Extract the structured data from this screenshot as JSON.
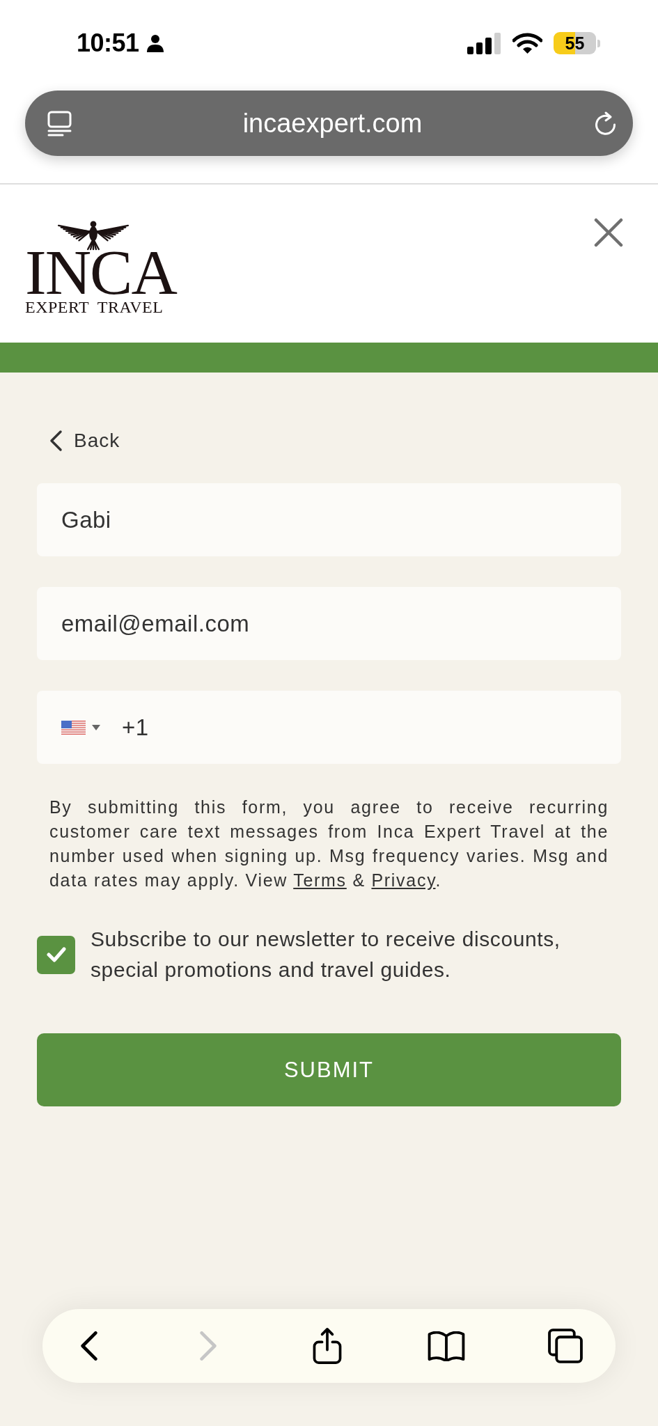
{
  "status_bar": {
    "time": "10:51",
    "battery": "55"
  },
  "address_bar": {
    "url": "incaexpert.com"
  },
  "header": {
    "logo_title": "INCA",
    "logo_subtitle": "EXPERT TRAVEL"
  },
  "form": {
    "back": "Back",
    "fields": [
      {
        "kind": "name",
        "value": "Gabi"
      },
      {
        "kind": "email",
        "value": "email@email.com"
      },
      {
        "kind": "phone",
        "value": "+1"
      }
    ],
    "consent": [
      {
        "kind": "text",
        "text": "By submitting this form, you agree to receive recurring customer care text messages from Inca Expert Travel at the number used when signing up. Msg frequency varies. Msg and data rates may apply. View "
      },
      {
        "kind": "link",
        "text": "Terms"
      },
      {
        "kind": "text",
        "text": " & "
      },
      {
        "kind": "link",
        "text": "Privacy"
      },
      {
        "kind": "text",
        "text": "."
      }
    ],
    "newsletter": {
      "checked": true,
      "label": "Subscribe to our newsletter to receive discounts, special promotions and travel guides."
    },
    "submit": "SUBMIT"
  },
  "toolbar": {
    "items": [
      {
        "kind": "back",
        "disabled": false
      },
      {
        "kind": "forward",
        "disabled": true
      },
      {
        "kind": "share",
        "disabled": false
      },
      {
        "kind": "bookmarks",
        "disabled": false
      },
      {
        "kind": "tabs",
        "disabled": false
      }
    ]
  }
}
